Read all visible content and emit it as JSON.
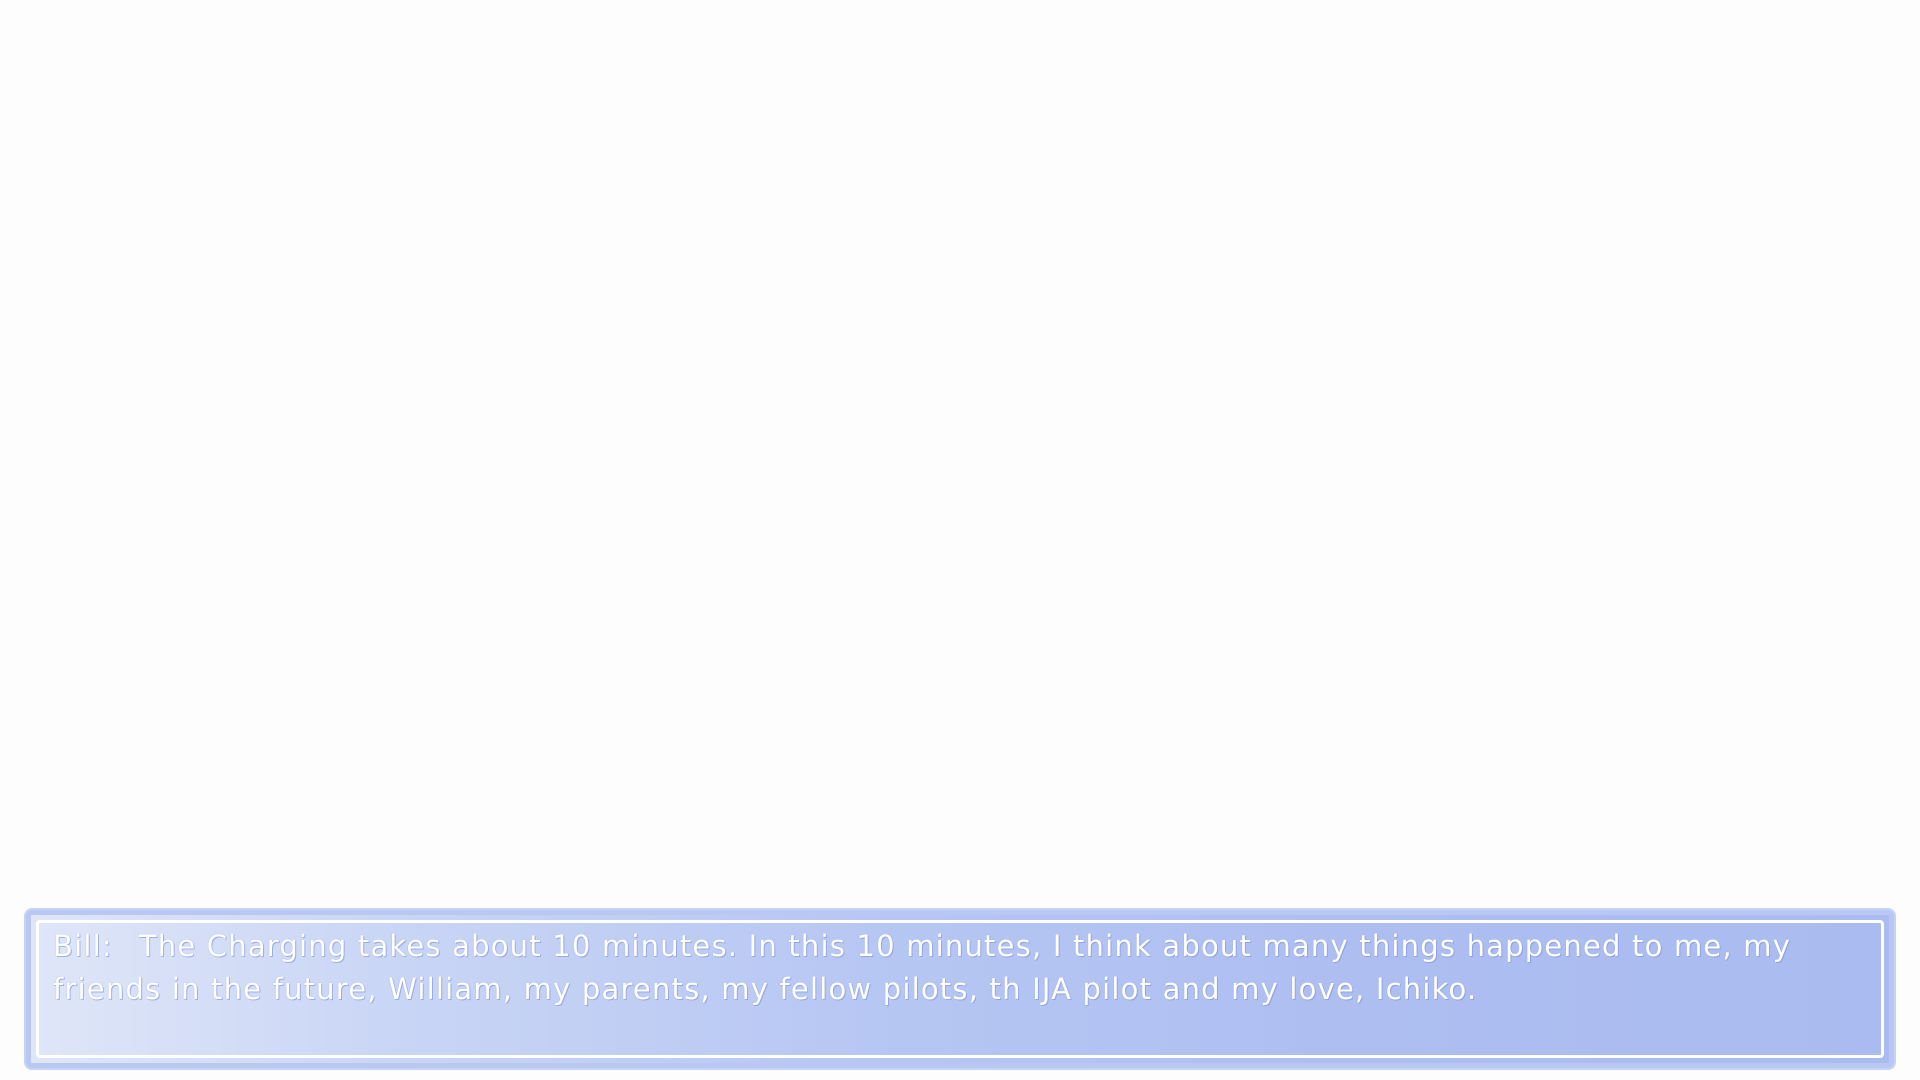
{
  "dialogue": {
    "speaker": "Bill:",
    "text": "The Charging takes about 10 minutes. In this 10 minutes, I think about many things happened to me, my friends in the future, William, my parents, my fellow pilots, th IJA pilot and my love, Ichiko."
  },
  "colors": {
    "background": "#fdfdfd",
    "box_gradient_start": "#dfe6f8",
    "box_gradient_end": "#a9bbf0",
    "text": "#ffffff"
  }
}
